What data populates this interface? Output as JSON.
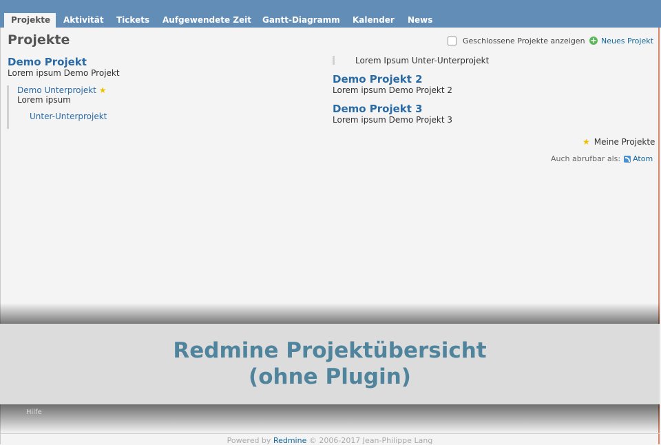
{
  "tabs": [
    "Projekte",
    "Aktivität",
    "Tickets",
    "Aufgewendete Zeit",
    "Gantt-Diagramm",
    "Kalender",
    "News"
  ],
  "page_title": "Projekte",
  "closed_projects_label": "Geschlossene Projekte anzeigen",
  "new_project_label": "Neues Projekt",
  "projects_left": {
    "demo1": {
      "name": "Demo Projekt",
      "description": "Lorem ipsum Demo Projekt"
    },
    "sub": {
      "name": "Demo Unterprojekt",
      "description": "Lorem ipsum"
    },
    "subsub": {
      "name": "Unter-Unterprojekt"
    }
  },
  "projects_right": {
    "subsub_desc": "Lorem Ipsum Unter-Unterprojekt",
    "demo2": {
      "name": "Demo Projekt 2",
      "description": "Lorem ipsum Demo Projekt 2"
    },
    "demo3": {
      "name": "Demo Projekt 3",
      "description": "Lorem ipsum Demo Projekt 3"
    }
  },
  "my_projects_label": "Meine Projekte",
  "also_available_label": "Auch abrufbar als:",
  "atom_label": "Atom",
  "banner": {
    "line1": "Redmine Projektübersicht",
    "line2": "(ohne Plugin)"
  },
  "faint_text": "Hilfe",
  "footer": {
    "prefix": "Powered by ",
    "link": "Redmine",
    "suffix": " © 2006-2017 Jean-Philippe Lang"
  },
  "colors": {
    "header": "#628db6",
    "link": "#2a6aa5",
    "banner_text": "#4f849c"
  }
}
